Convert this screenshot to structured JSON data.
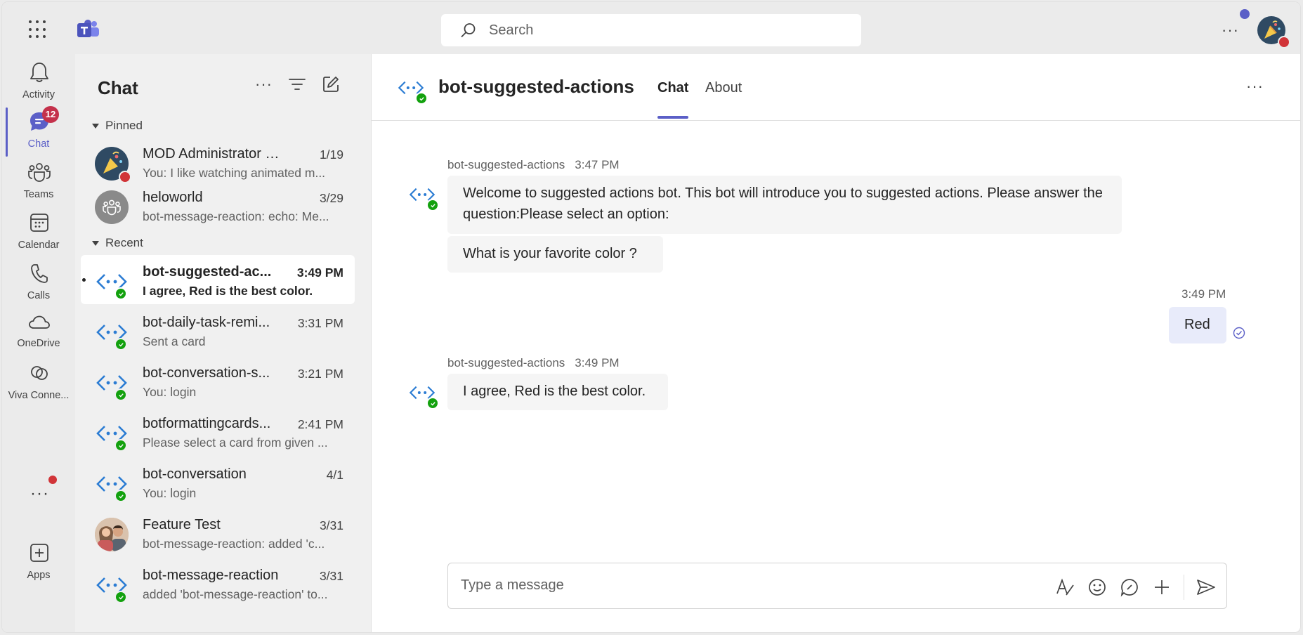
{
  "topbar": {
    "search_placeholder": "Search",
    "more_label": "···"
  },
  "rail": {
    "items": [
      {
        "label": "Activity",
        "icon": "bell-icon"
      },
      {
        "label": "Chat",
        "icon": "chat-icon",
        "badge": "12"
      },
      {
        "label": "Teams",
        "icon": "teams-icon"
      },
      {
        "label": "Calendar",
        "icon": "calendar-icon"
      },
      {
        "label": "Calls",
        "icon": "phone-icon"
      },
      {
        "label": "OneDrive",
        "icon": "cloud-icon"
      },
      {
        "label": "Viva Conne...",
        "icon": "viva-connections-icon"
      },
      {
        "label": "Apps",
        "icon": "add-apps-icon"
      }
    ],
    "more_label": "···"
  },
  "chatlist": {
    "title": "Chat",
    "pinned_label": "Pinned",
    "recent_label": "Recent",
    "pinned": [
      {
        "name": "MOD Administrator (Y...",
        "time": "1/19",
        "preview": "You: I like watching animated m..."
      },
      {
        "name": "heloworld",
        "time": "3/29",
        "preview": "bot-message-reaction: echo: Me..."
      }
    ],
    "recent": [
      {
        "name": "bot-suggested-ac...",
        "time": "3:49 PM",
        "preview": "I agree, Red is the best color."
      },
      {
        "name": "bot-daily-task-remi...",
        "time": "3:31 PM",
        "preview": "Sent a card"
      },
      {
        "name": "bot-conversation-s...",
        "time": "3:21 PM",
        "preview": "You: login"
      },
      {
        "name": "botformattingcards...",
        "time": "2:41 PM",
        "preview": "Please select a card from given ..."
      },
      {
        "name": "bot-conversation",
        "time": "4/1",
        "preview": "You: login"
      },
      {
        "name": "Feature Test",
        "time": "3/31",
        "preview": "bot-message-reaction: added 'c..."
      },
      {
        "name": "bot-message-reaction",
        "time": "3/31",
        "preview": "added 'bot-message-reaction' to..."
      }
    ]
  },
  "conversation": {
    "title": "bot-suggested-actions",
    "tabs": [
      "Chat",
      "About"
    ],
    "messages": [
      {
        "sender": "bot-suggested-actions",
        "time": "3:47 PM",
        "text_1": "Welcome to suggested actions bot. This bot will introduce you to suggested actions. Please answer the question:Please select an option:",
        "text_2": "What is your favorite color ?"
      },
      {
        "sender": "",
        "time": "3:49 PM",
        "text": "Red"
      },
      {
        "sender": "bot-suggested-actions",
        "time": "3:49 PM",
        "text": "I agree, Red is the best color."
      }
    ],
    "composer_placeholder": "Type a message"
  },
  "colors": {
    "accent": "#5b5fc7",
    "bot_icon": "#2b7cd3",
    "online": "#13a10e",
    "badge": "#c4314b"
  }
}
